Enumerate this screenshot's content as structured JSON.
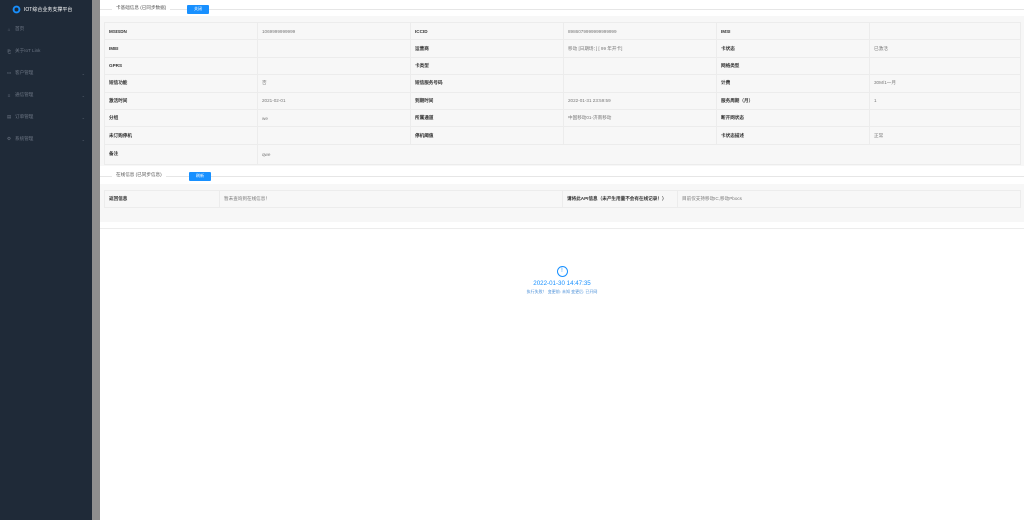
{
  "app": {
    "title": "IOT综合业务支撑平台"
  },
  "sidebar": {
    "items": [
      {
        "label": "首页",
        "icon": "home-icon",
        "glyph": "⌂",
        "chevron": false
      },
      {
        "label": "关于IoT Link",
        "icon": "info-icon",
        "glyph": "⎗",
        "chevron": false
      },
      {
        "label": "客户管理",
        "icon": "monitor-icon",
        "glyph": "▭",
        "chevron": true
      },
      {
        "label": "通信管理",
        "icon": "list-icon",
        "glyph": "≡",
        "chevron": true
      },
      {
        "label": "订单管理",
        "icon": "order-icon",
        "glyph": "▤",
        "chevron": true
      },
      {
        "label": "系统管理",
        "icon": "gear-icon",
        "glyph": "⚙",
        "chevron": true
      }
    ]
  },
  "card_info": {
    "label": "卡基础信息 (已同步数据)",
    "button": "关闭",
    "rows": [
      [
        "MSISDN",
        "1069999999999",
        "ICCID",
        "8986079999999999999",
        "IMSI",
        ""
      ],
      [
        "IMEI",
        "",
        "运营商",
        "移动 [日期场：] [ 99 年开卡]",
        "卡状态",
        "已激活"
      ],
      [
        "GPRS",
        "",
        "卡类型",
        "",
        "网络类型",
        ""
      ],
      [
        "短信功能",
        "否",
        "短信服务号码",
        "",
        "计费",
        "30M/1一月"
      ],
      [
        "激活时间",
        "2021-02-01",
        "到期时间",
        "2022-01-31 23:59:59",
        "服务周期（月）",
        "1"
      ],
      [
        "分组",
        "we",
        "所属通道",
        "中国移动01-济南移动",
        "断开网状态",
        ""
      ],
      [
        "未订购停机",
        "",
        "停机阈值",
        "",
        "卡状态描述",
        "正常"
      ]
    ],
    "remark_label": "备注",
    "remark_value": "qwe"
  },
  "online_info": {
    "label": "在线信息 (已同步信息)",
    "button": "刷新",
    "return_label": "返回信息",
    "return_value": "暂未查询到在线信息！",
    "api_label": "请将此API信息（未产生用量不会有在线记录！）",
    "api_value": "目前仅支持移动IC,移动Pbocs"
  },
  "status": {
    "icon": "info-circle-icon",
    "time": "2022-01-30 14:47:35",
    "description": "执行失败！ 变更前: 未知 变更后: 已开网"
  },
  "colors": {
    "sidebar": "#1f2a38",
    "accent": "#1890ff"
  }
}
